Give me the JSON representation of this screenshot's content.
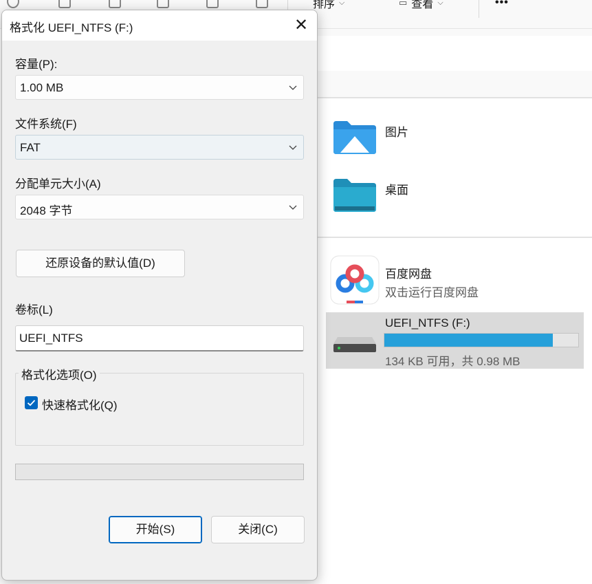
{
  "explorer": {
    "toolbar": {
      "sort_label": "排序",
      "view_label": "查看",
      "more_label": "•••"
    },
    "items": [
      {
        "name": "图片",
        "icon": "pictures-folder-icon"
      },
      {
        "name": "桌面",
        "icon": "desktop-folder-icon"
      }
    ],
    "app": {
      "name": "百度网盘",
      "subtitle": "双击运行百度网盘",
      "icon": "baidu-netdisk-icon"
    },
    "drive": {
      "name": "UEFI_NTFS (F:)",
      "space_text": "134 KB 可用，共 0.98 MB",
      "used_fraction": 0.87,
      "icon": "drive-icon"
    }
  },
  "dialog": {
    "title": "格式化 UEFI_NTFS (F:)",
    "capacity": {
      "label": "容量(P):",
      "value": "1.00 MB"
    },
    "filesystem": {
      "label": "文件系统(F)",
      "value": "FAT"
    },
    "allocation": {
      "label": "分配单元大小(A)",
      "value": "2048 字节"
    },
    "restore_button": "还原设备的默认值(D)",
    "volume_label": {
      "label": "卷标(L)",
      "value": "UEFI_NTFS"
    },
    "format_options": {
      "legend": "格式化选项(O)",
      "quick_format": {
        "label": "快速格式化(Q)",
        "checked": true
      }
    },
    "progress": 0,
    "start_button": "开始(S)",
    "close_button": "关闭(C)"
  },
  "colors": {
    "accent": "#0067c0",
    "drive_bar": "#26a0da",
    "selection": "#dadada"
  }
}
